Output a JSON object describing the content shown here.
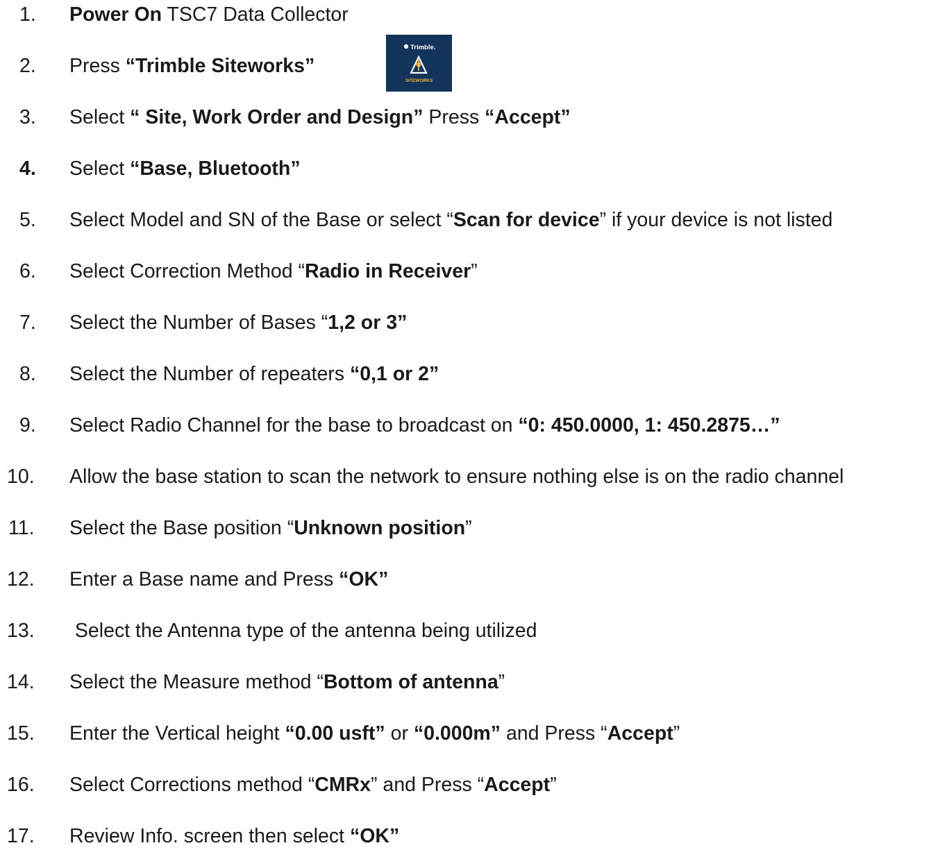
{
  "logo": {
    "brand_text": "Trimble.",
    "product_text": "SITEWORKS",
    "background_color": "#12335a",
    "accent_color": "#f2b233"
  },
  "steps": [
    {
      "number": "1.",
      "bold_number": false,
      "segments": [
        {
          "text": "Power On",
          "bold": true
        },
        {
          "text": " TSC7 Data Collector",
          "bold": false
        }
      ]
    },
    {
      "number": "2.",
      "bold_number": false,
      "segments": [
        {
          "text": "Press ",
          "bold": false
        },
        {
          "text": "“Trimble Siteworks”",
          "bold": true
        }
      ]
    },
    {
      "number": "3.",
      "bold_number": false,
      "segments": [
        {
          "text": "Select ",
          "bold": false
        },
        {
          "text": "“ Site, Work Order and Design”",
          "bold": true
        },
        {
          "text": " Press ",
          "bold": false
        },
        {
          "text": "“Accept”",
          "bold": true
        }
      ]
    },
    {
      "number": "4.",
      "bold_number": true,
      "segments": [
        {
          "text": "Select ",
          "bold": false
        },
        {
          "text": "“Base, Bluetooth”",
          "bold": true
        }
      ]
    },
    {
      "number": "5.",
      "bold_number": false,
      "segments": [
        {
          "text": "Select Model and SN of the Base or select “",
          "bold": false
        },
        {
          "text": "Scan for device",
          "bold": true
        },
        {
          "text": "” if your device is not listed",
          "bold": false
        }
      ]
    },
    {
      "number": "6.",
      "bold_number": false,
      "segments": [
        {
          "text": "Select Correction Method “",
          "bold": false
        },
        {
          "text": "Radio in Receiver",
          "bold": true
        },
        {
          "text": "”",
          "bold": false
        }
      ]
    },
    {
      "number": "7.",
      "bold_number": false,
      "segments": [
        {
          "text": "Select the Number of Bases “",
          "bold": false
        },
        {
          "text": "1,2 or 3”",
          "bold": true
        }
      ]
    },
    {
      "number": "8.",
      "bold_number": false,
      "segments": [
        {
          "text": "Select the Number of repeaters ",
          "bold": false
        },
        {
          "text": "“0,1 or 2”",
          "bold": true
        }
      ]
    },
    {
      "number": "9.",
      "bold_number": false,
      "segments": [
        {
          "text": "Select Radio Channel for the base to broadcast on ",
          "bold": false
        },
        {
          "text": "“0: 450.0000, 1: 450.2875…”",
          "bold": true
        }
      ]
    },
    {
      "number": "10.",
      "bold_number": false,
      "segments": [
        {
          "text": "Allow the base station to scan the network to ensure nothing else is on the radio channel",
          "bold": false
        }
      ]
    },
    {
      "number": "11.",
      "bold_number": false,
      "segments": [
        {
          "text": "Select the Base position “",
          "bold": false
        },
        {
          "text": "Unknown position",
          "bold": true
        },
        {
          "text": "”",
          "bold": false
        }
      ]
    },
    {
      "number": "12.",
      "bold_number": false,
      "segments": [
        {
          "text": "Enter a Base name and Press ",
          "bold": false
        },
        {
          "text": "“OK”",
          "bold": true
        }
      ]
    },
    {
      "number": "13.",
      "bold_number": false,
      "segments": [
        {
          "text": " Select the Antenna type of the antenna being utilized",
          "bold": false
        }
      ]
    },
    {
      "number": "14.",
      "bold_number": false,
      "segments": [
        {
          "text": "Select the Measure method “",
          "bold": false
        },
        {
          "text": "Bottom of antenna",
          "bold": true
        },
        {
          "text": "”",
          "bold": false
        }
      ]
    },
    {
      "number": "15.",
      "bold_number": false,
      "segments": [
        {
          "text": "Enter the Vertical height ",
          "bold": false
        },
        {
          "text": "“0.00 usft”",
          "bold": true
        },
        {
          "text": " or ",
          "bold": false
        },
        {
          "text": "“0.000m”",
          "bold": true
        },
        {
          "text": " and Press “",
          "bold": false
        },
        {
          "text": "Accept",
          "bold": true
        },
        {
          "text": "”",
          "bold": false
        }
      ]
    },
    {
      "number": "16.",
      "bold_number": false,
      "segments": [
        {
          "text": "Select Corrections method “",
          "bold": false
        },
        {
          "text": "CMRx",
          "bold": true
        },
        {
          "text": "” and Press “",
          "bold": false
        },
        {
          "text": "Accept",
          "bold": true
        },
        {
          "text": "”",
          "bold": false
        }
      ]
    },
    {
      "number": "17.",
      "bold_number": false,
      "segments": [
        {
          "text": "Review Info. screen then select ",
          "bold": false
        },
        {
          "text": "“OK”",
          "bold": true
        }
      ]
    }
  ]
}
